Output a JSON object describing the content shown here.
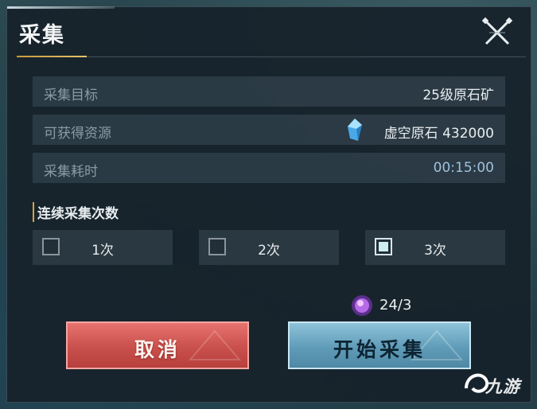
{
  "dialog": {
    "title": "采集",
    "close_icon": "close-icon"
  },
  "info_rows": [
    {
      "label": "采集目标",
      "value": "25级原石矿"
    },
    {
      "label": "可获得资源",
      "value": "虚空原石 432000",
      "icon": "crystal-icon"
    },
    {
      "label": "采集耗时",
      "value": "00:15:00"
    }
  ],
  "repeat": {
    "title": "连续采集次数",
    "options": [
      {
        "label": "1次",
        "checked": false
      },
      {
        "label": "2次",
        "checked": false
      },
      {
        "label": "3次",
        "checked": true
      }
    ]
  },
  "cost": {
    "icon": "energy-orb-icon",
    "text": "24/3"
  },
  "buttons": {
    "cancel_label": "取消",
    "start_label": "开始采集"
  },
  "watermark": {
    "text": "九游"
  },
  "colors": {
    "accent_gold": "#d6a23e",
    "cancel_red": "#c9504c",
    "start_blue": "#5f9cb8",
    "time_blue": "#9fc3e0"
  }
}
